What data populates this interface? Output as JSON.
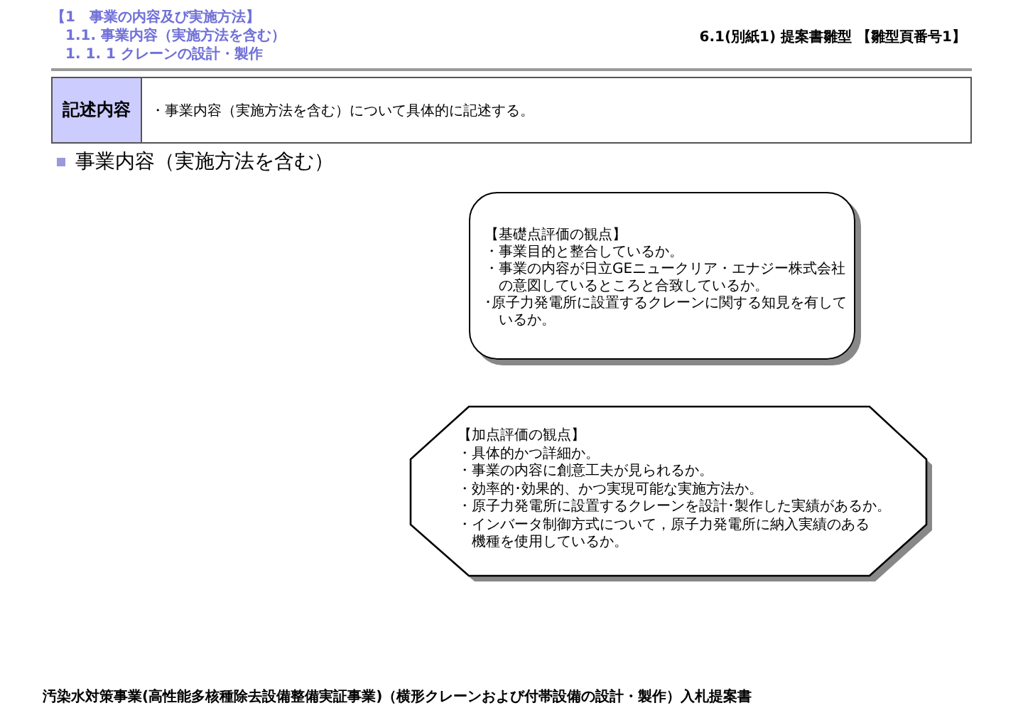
{
  "header": {
    "breadcrumbs": [
      "【1　事業の内容及び実施方法】",
      "1.1. 事業内容（実施方法を含む）",
      "1. 1. 1  クレーンの設計・製作"
    ],
    "doc_title": "6.1(別紙1) 提案書雛型 【雛型頁番号1】"
  },
  "description_table": {
    "label": "記述内容",
    "text": "・事業内容（実施方法を含む）について具体的に記述する。"
  },
  "section_heading": "事業内容（実施方法を含む）",
  "callouts": [
    {
      "kind": "rounded",
      "title": "【基礎点評価の観点】",
      "lines": [
        "・事業目的と整合しているか。",
        "・事業の内容が日立GEニュークリア・エナジー株式会社",
        "　の意図しているところと合致しているか。",
        "･原子力発電所に設置するクレーンに関する知見を有して",
        "　いるか。"
      ]
    },
    {
      "kind": "octagon",
      "title": "【加点評価の観点】",
      "lines": [
        "・具体的かつ詳細か。",
        "・事業の内容に創意工夫が見られるか。",
        "・効率的･効果的、かつ実現可能な実施方法か。",
        "・原子力発電所に設置するクレーンを設計･製作した実績があるか。",
        "・インバータ制御方式について，原子力発電所に納入実績のある",
        "　機種を使用しているか。"
      ]
    }
  ],
  "footer": "汚染水対策事業(高性能多核種除去設備整備実証事業)（横形クレーンおよび付帯設備の設計・製作）入札提案書"
}
